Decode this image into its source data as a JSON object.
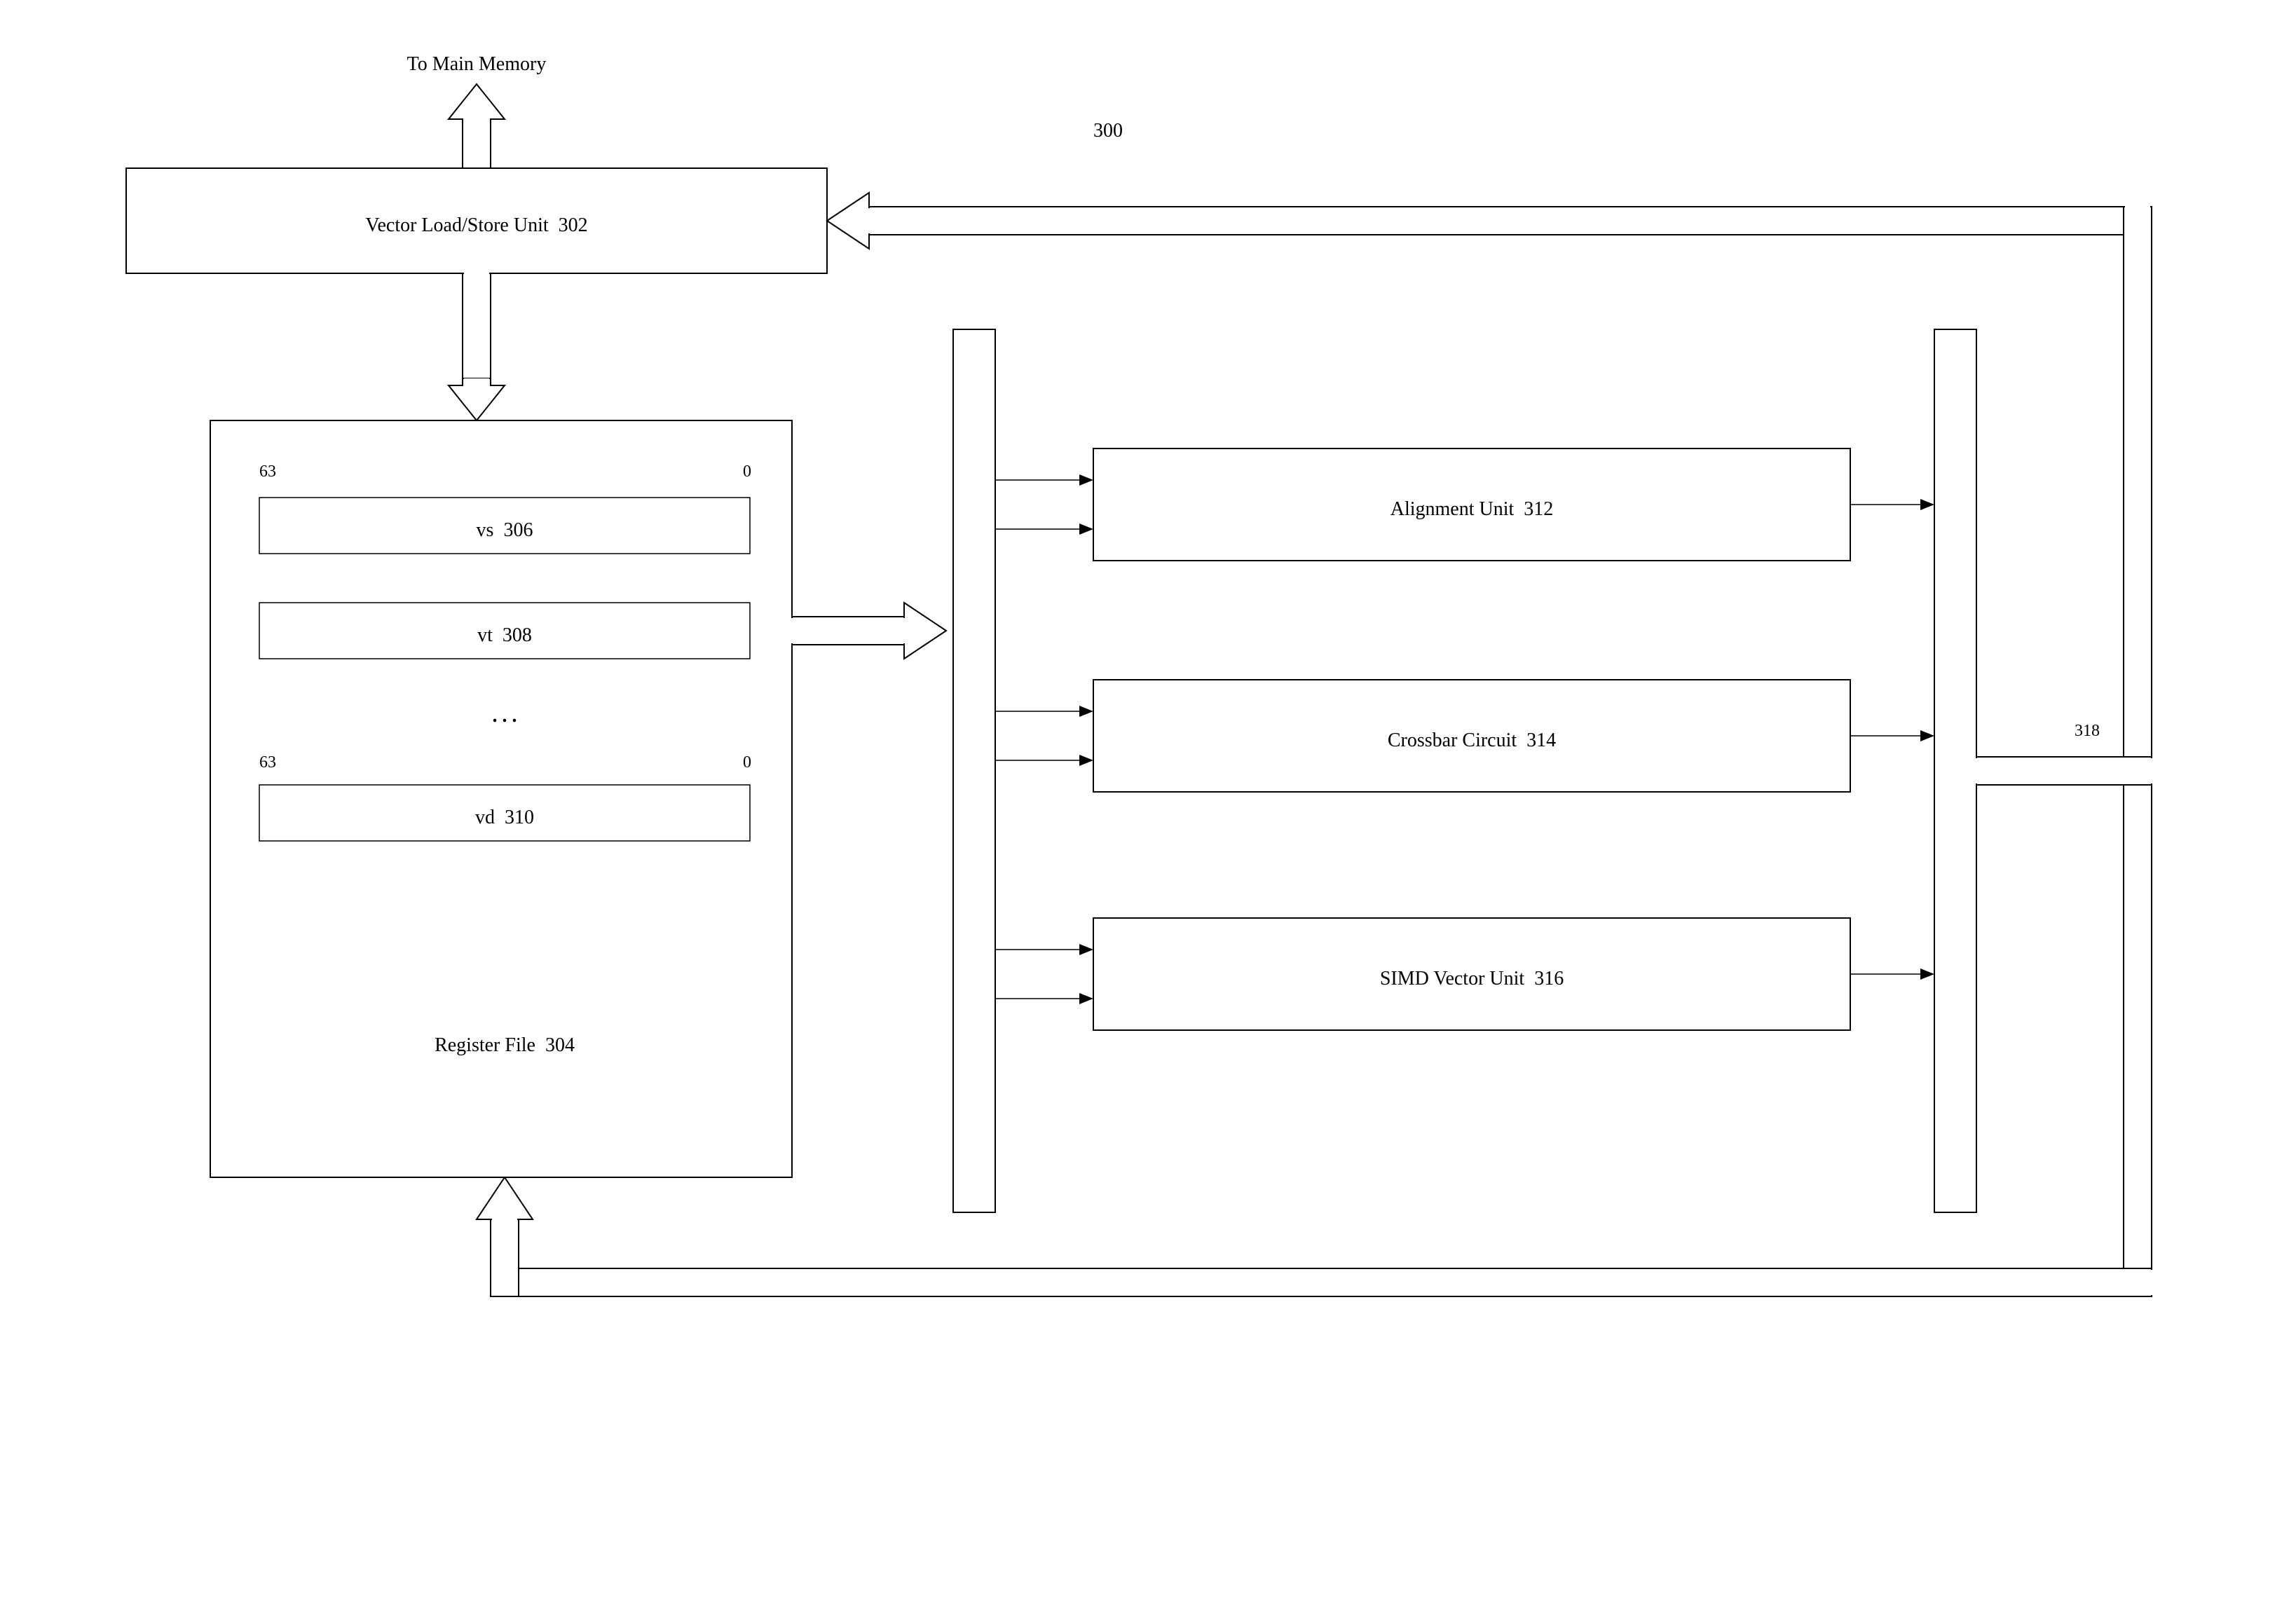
{
  "diagramId": "300",
  "topLabel": "To Main Memory",
  "vlsu": {
    "label": "Vector Load/Store Unit",
    "id": "302"
  },
  "regFile": {
    "label": "Register File",
    "id": "304",
    "msb": "63",
    "lsb": "0",
    "regs": [
      {
        "name": "vs",
        "id": "306"
      },
      {
        "name": "vt",
        "id": "308"
      },
      {
        "name": "vd",
        "id": "310"
      }
    ],
    "ellipsis": ". . ."
  },
  "units": [
    {
      "label": "Alignment Unit",
      "id": "312"
    },
    {
      "label": "Crossbar Circuit",
      "id": "314"
    },
    {
      "label": "SIMD Vector Unit",
      "id": "316"
    }
  ],
  "outBusId": "318"
}
